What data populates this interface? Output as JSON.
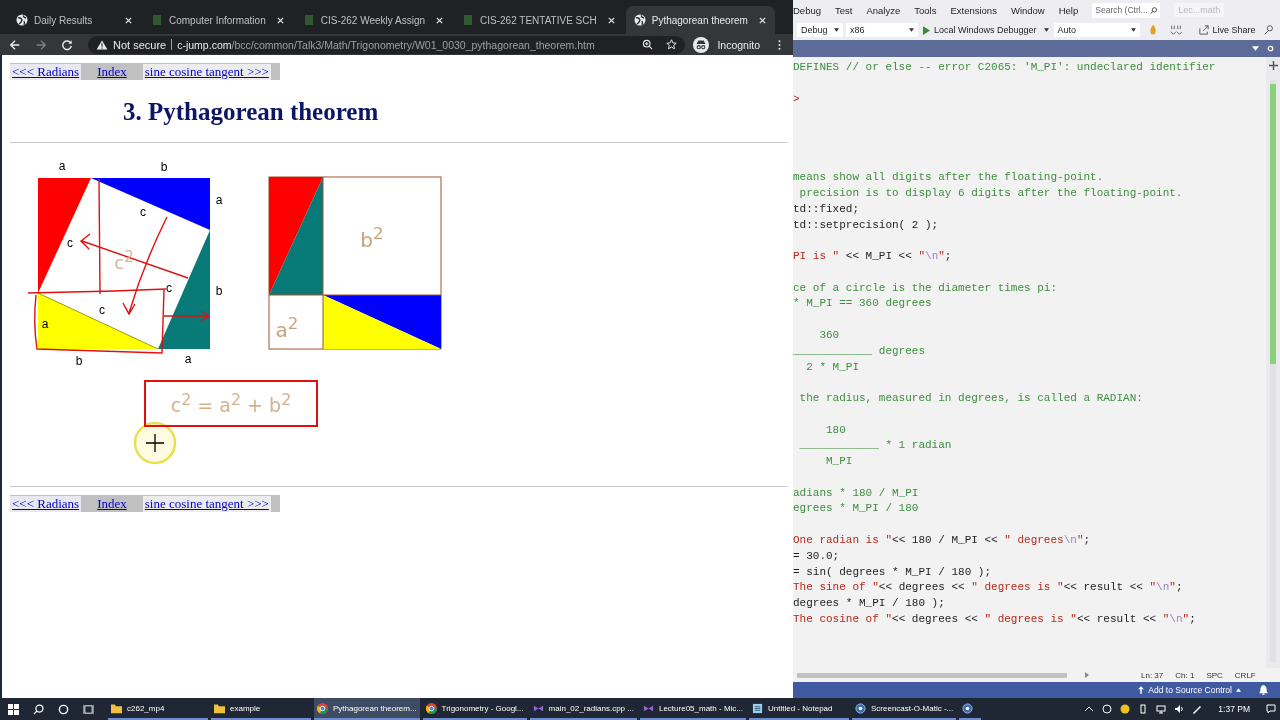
{
  "browser": {
    "tabs": [
      {
        "title": "Daily Results",
        "kind": "globe",
        "selected": false
      },
      {
        "title": "Computer Information",
        "kind": "page",
        "selected": false
      },
      {
        "title": "CIS-262 Weekly Assign",
        "kind": "page",
        "selected": false
      },
      {
        "title": "CIS-262 TENTATIVE SCH",
        "kind": "page",
        "selected": false
      },
      {
        "title": "Pythagorean theorem",
        "kind": "globe",
        "selected": true
      }
    ],
    "security": "Not secure",
    "domain": "c-jump.com",
    "path": "/bcc/common/Talk3/Math/Trigonometry/W01_0030_pythagorean_theorem.htm",
    "profile": "Incognito"
  },
  "page": {
    "nav_top": [
      {
        "label": "<<< Radians"
      },
      {
        "label": "Index"
      },
      {
        "label": "sine cosine tangent >>>"
      }
    ],
    "heading": "3. Pythagorean theorem",
    "left_square_labels": [
      "a",
      "b",
      "a",
      "b",
      "b",
      "a",
      "c",
      "c",
      "c",
      "c",
      "a"
    ],
    "left_area_label": "c$^{2}$",
    "right_area_labels": [
      "b$^{2}$",
      "a$^{2}$"
    ],
    "formula": "c$^{2}$ = a$^{2}$ + b$^{2}$",
    "nav_bottom": [
      {
        "label": "<<< Radians"
      },
      {
        "label": "Index"
      },
      {
        "label": "sine cosine tangent >>>"
      }
    ]
  },
  "ide": {
    "menu": [
      "Debug",
      "Test",
      "Analyze",
      "Tools",
      "Extensions",
      "Window",
      "Help"
    ],
    "search": {
      "placeholder": "Search (Ctrl..."
    },
    "title": "Lec...math",
    "configuration": "Debug",
    "platform": "x86",
    "run": "Local Windows Debugger",
    "mode": "Auto",
    "live_share": "Live Share",
    "lines": [
      {
        "kind": "code",
        "tokens": [
          {
            "kind": "comment",
            "text": "DEFINES // or else -- error C2065: 'M_PI': undeclared identifier"
          }
        ]
      },
      {
        "kind": "blank"
      },
      {
        "kind": "code",
        "tokens": [
          {
            "kind": "string",
            "text": ">"
          }
        ]
      },
      {
        "kind": "blank"
      },
      {
        "kind": "blank"
      },
      {
        "kind": "blank"
      },
      {
        "kind": "blank"
      },
      {
        "kind": "code",
        "tokens": [
          {
            "kind": "comment",
            "text": "means show all digits after the floating-point."
          }
        ]
      },
      {
        "kind": "code",
        "tokens": [
          {
            "kind": "comment",
            "text": " precision is to display 6 digits after the floating-point."
          }
        ]
      },
      {
        "kind": "code",
        "tokens": [
          {
            "kind": "plain",
            "text": "td::fixed;"
          }
        ]
      },
      {
        "kind": "code",
        "tokens": [
          {
            "kind": "plain",
            "text": "td::setprecision( 2 );"
          }
        ]
      },
      {
        "kind": "blank"
      },
      {
        "kind": "code",
        "tokens": [
          {
            "kind": "string",
            "text": "PI is \" "
          },
          {
            "kind": "plain",
            "text": "<< M_PI << "
          },
          {
            "kind": "string",
            "text": "\""
          },
          {
            "kind": "escape",
            "text": "\\n"
          },
          {
            "kind": "string",
            "text": "\""
          },
          {
            "kind": "plain",
            "text": ";"
          }
        ]
      },
      {
        "kind": "blank"
      },
      {
        "kind": "code",
        "tokens": [
          {
            "kind": "comment",
            "text": "ce of a circle is the diameter times pi:"
          }
        ]
      },
      {
        "kind": "code",
        "tokens": [
          {
            "kind": "comment",
            "text": "* M_PI == 360 degrees"
          }
        ]
      },
      {
        "kind": "blank"
      },
      {
        "kind": "code",
        "tokens": [
          {
            "kind": "comment",
            "text": "    360"
          }
        ]
      },
      {
        "kind": "code",
        "tokens": [
          {
            "kind": "comment",
            "text": "____________ degrees"
          }
        ]
      },
      {
        "kind": "code",
        "tokens": [
          {
            "kind": "comment",
            "text": "  2 * M_PI"
          }
        ]
      },
      {
        "kind": "blank"
      },
      {
        "kind": "code",
        "tokens": [
          {
            "kind": "comment",
            "text": " the radius, measured in degrees, is called a RADIAN:"
          }
        ]
      },
      {
        "kind": "blank"
      },
      {
        "kind": "code",
        "tokens": [
          {
            "kind": "comment",
            "text": "     180"
          }
        ]
      },
      {
        "kind": "code",
        "tokens": [
          {
            "kind": "comment",
            "text": " ____________ * 1 radian"
          }
        ]
      },
      {
        "kind": "code",
        "tokens": [
          {
            "kind": "comment",
            "text": "     M_PI"
          }
        ]
      },
      {
        "kind": "blank"
      },
      {
        "kind": "code",
        "tokens": [
          {
            "kind": "comment",
            "text": "adians * 180 / M_PI"
          }
        ]
      },
      {
        "kind": "code",
        "tokens": [
          {
            "kind": "comment",
            "text": "egrees * M_PI / 180"
          }
        ]
      },
      {
        "kind": "blank"
      },
      {
        "kind": "code",
        "tokens": [
          {
            "kind": "string",
            "text": "One radian is \""
          },
          {
            "kind": "plain",
            "text": "<< 180 / M_PI << "
          },
          {
            "kind": "string",
            "text": "\" degrees"
          },
          {
            "kind": "escape",
            "text": "\\n"
          },
          {
            "kind": "string",
            "text": "\""
          },
          {
            "kind": "plain",
            "text": ";"
          }
        ]
      },
      {
        "kind": "code",
        "tokens": [
          {
            "kind": "plain",
            "text": "= 30.0;"
          }
        ]
      },
      {
        "kind": "code",
        "tokens": [
          {
            "kind": "plain",
            "text": "= sin( degrees * M_PI / 180 );"
          }
        ]
      },
      {
        "kind": "code",
        "tokens": [
          {
            "kind": "string",
            "text": "The sine of \""
          },
          {
            "kind": "plain",
            "text": "<< degrees << "
          },
          {
            "kind": "string",
            "text": "\" degrees is \""
          },
          {
            "kind": "plain",
            "text": "<< result << "
          },
          {
            "kind": "string",
            "text": "\""
          },
          {
            "kind": "escape",
            "text": "\\n"
          },
          {
            "kind": "string",
            "text": "\""
          },
          {
            "kind": "plain",
            "text": ";"
          }
        ]
      },
      {
        "kind": "code",
        "tokens": [
          {
            "kind": "plain",
            "text": "degrees * M_PI / 180 );"
          }
        ]
      },
      {
        "kind": "code",
        "tokens": [
          {
            "kind": "string",
            "text": "The cosine of \""
          },
          {
            "kind": "plain",
            "text": "<< degrees << "
          },
          {
            "kind": "string",
            "text": "\" degrees is \""
          },
          {
            "kind": "plain",
            "text": "<< result << "
          },
          {
            "kind": "string",
            "text": "\""
          },
          {
            "kind": "escape",
            "text": "\\n"
          },
          {
            "kind": "string",
            "text": "\""
          },
          {
            "kind": "plain",
            "text": ";"
          }
        ]
      }
    ],
    "status": {
      "line": "Ln: 37",
      "column": "Ch: 1",
      "indent": "SPC",
      "line_ending": "CRLF",
      "source_control": "Add to Source Control"
    }
  },
  "taskbar": {
    "items": [
      {
        "kind": "folder",
        "label": "c262_mp4",
        "selected": false
      },
      {
        "kind": "folder",
        "label": "example",
        "selected": false
      },
      {
        "kind": "browser",
        "label": "Pythagorean theorem...",
        "selected": true
      },
      {
        "kind": "browser",
        "label": "Trigonometry - Googl...",
        "selected": false
      },
      {
        "kind": "studio",
        "label": "main_02_radians.cpp ...",
        "selected": false
      },
      {
        "kind": "studio",
        "label": "Lecture05_math - Mic...",
        "selected": false
      },
      {
        "kind": "notepad",
        "label": "Untitled - Notepad",
        "selected": false
      },
      {
        "kind": "recorder",
        "label": "Screencast-O-Matic -...",
        "selected": false
      },
      {
        "kind": "recorder",
        "selected": false
      }
    ],
    "time": "1:37 PM"
  }
}
